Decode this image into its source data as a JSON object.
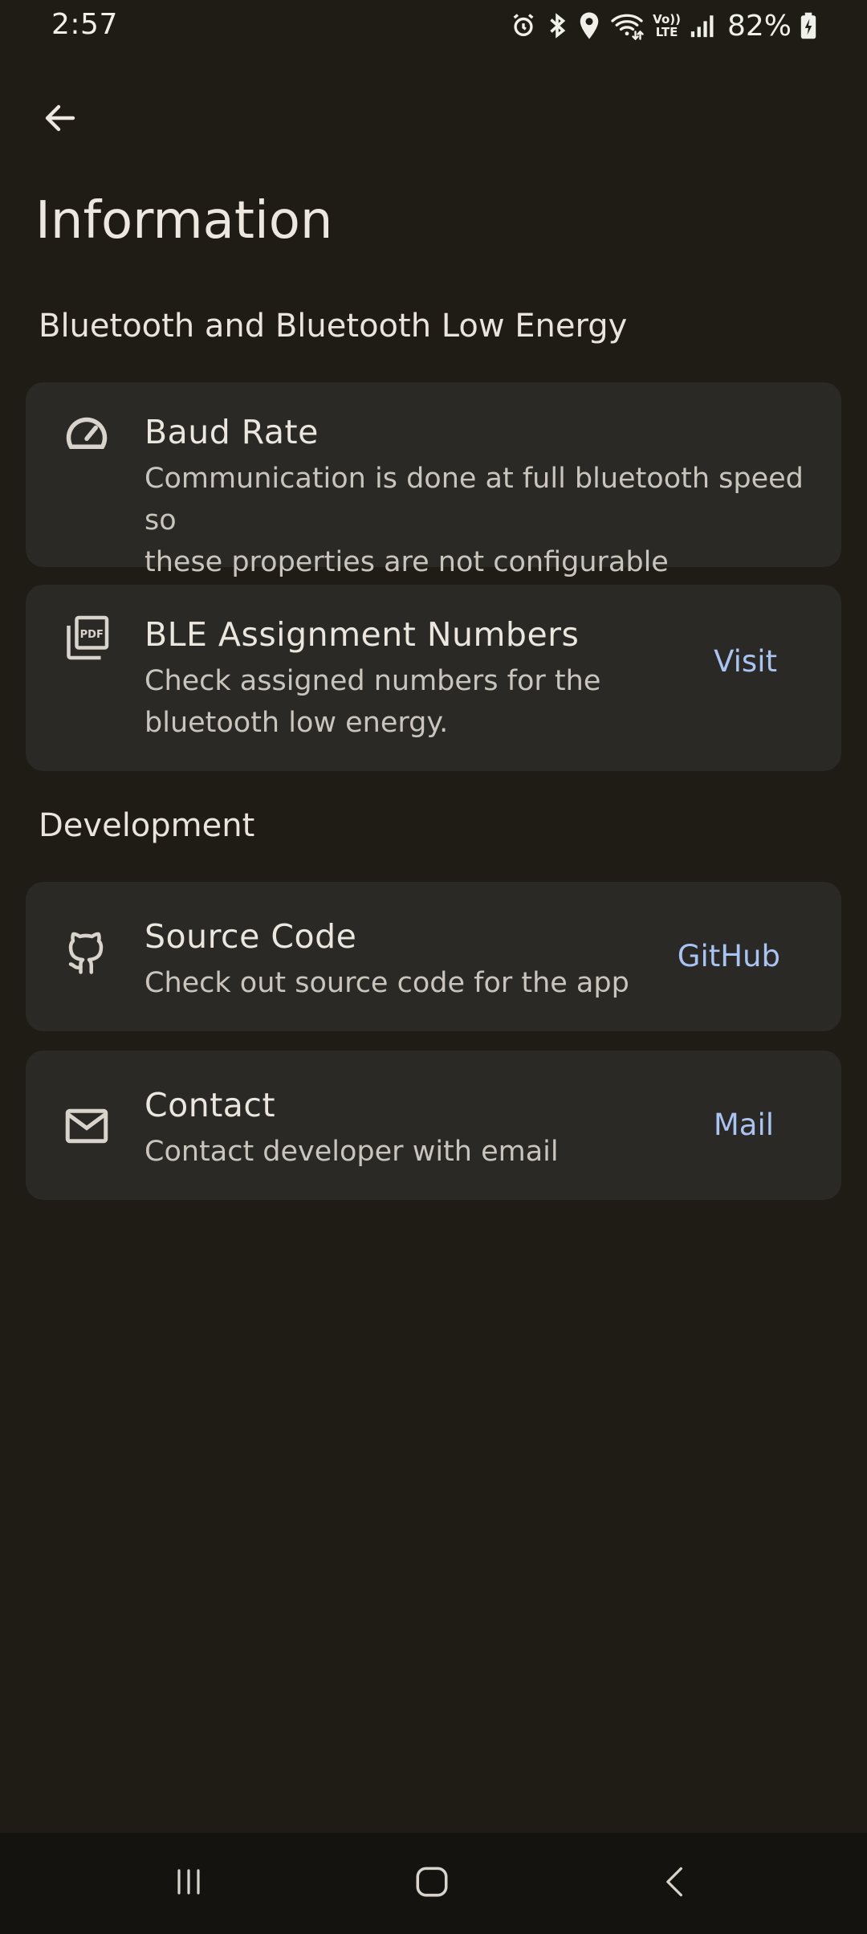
{
  "status_bar": {
    "time": "2:57",
    "battery": "82%",
    "icons": [
      "alarm-icon",
      "bluetooth-icon",
      "location-icon",
      "wifi-icon",
      "volte-icon",
      "signal-icon",
      "battery-charging-icon"
    ],
    "volte_top": "Vo))",
    "volte_bottom": "LTE"
  },
  "app_bar": {
    "back_icon": "arrow-back-icon",
    "title": "Information"
  },
  "sections": [
    {
      "header": "Bluetooth and Bluetooth Low Energy",
      "items": [
        {
          "icon": "speedometer-icon",
          "title": "Baud Rate",
          "description_lines": [
            "Communication is done at full bluetooth speed so",
            "these properties are not configurable"
          ],
          "action": ""
        },
        {
          "icon": "pdf-document-icon",
          "title": "BLE Assignment Numbers",
          "description_lines": [
            "Check assigned numbers for the",
            "bluetooth low energy."
          ],
          "action": "Visit"
        }
      ]
    },
    {
      "header": "Development",
      "items": [
        {
          "icon": "github-icon",
          "title": "Source Code",
          "description_lines": [
            "Check out source code for the app"
          ],
          "action": "GitHub"
        },
        {
          "icon": "mail-icon",
          "title": "Contact",
          "description_lines": [
            "Contact developer with email"
          ],
          "action": "Mail"
        }
      ]
    }
  ],
  "nav_bar": {
    "buttons": [
      "recent-apps-icon",
      "home-icon",
      "back-icon"
    ]
  },
  "colors": {
    "background": "#1f1c16",
    "card": "#2a2926",
    "accent": "#a9c3f2",
    "nav_bar": "#14130f"
  }
}
